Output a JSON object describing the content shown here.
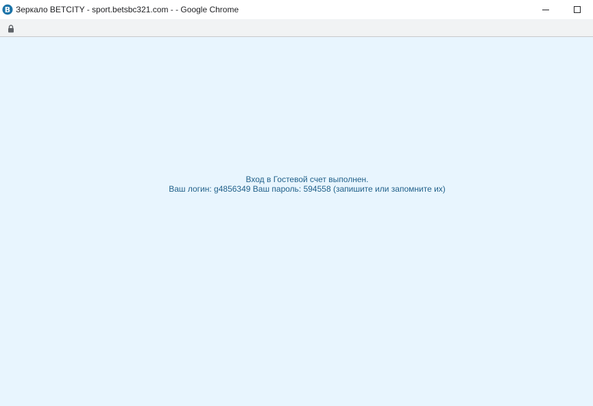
{
  "window": {
    "title": "Зеркало BETCITY - sport.betsbc321.com - - Google Chrome",
    "favicon": "betcity-logo-icon",
    "controls": [
      "minimize-icon",
      "maximize-icon"
    ]
  },
  "addressbar": {
    "icon": "lock-icon"
  },
  "message": {
    "line1": "Вход в Гостевой счет выполнен.",
    "line2": "Ваш логин: g4856349 Ваш пароль: 594558 (запишите или запомните их)"
  },
  "colors": {
    "page_background": "#e8f5fe",
    "message_text": "#1f5f89",
    "favicon": "#1d74a8"
  }
}
